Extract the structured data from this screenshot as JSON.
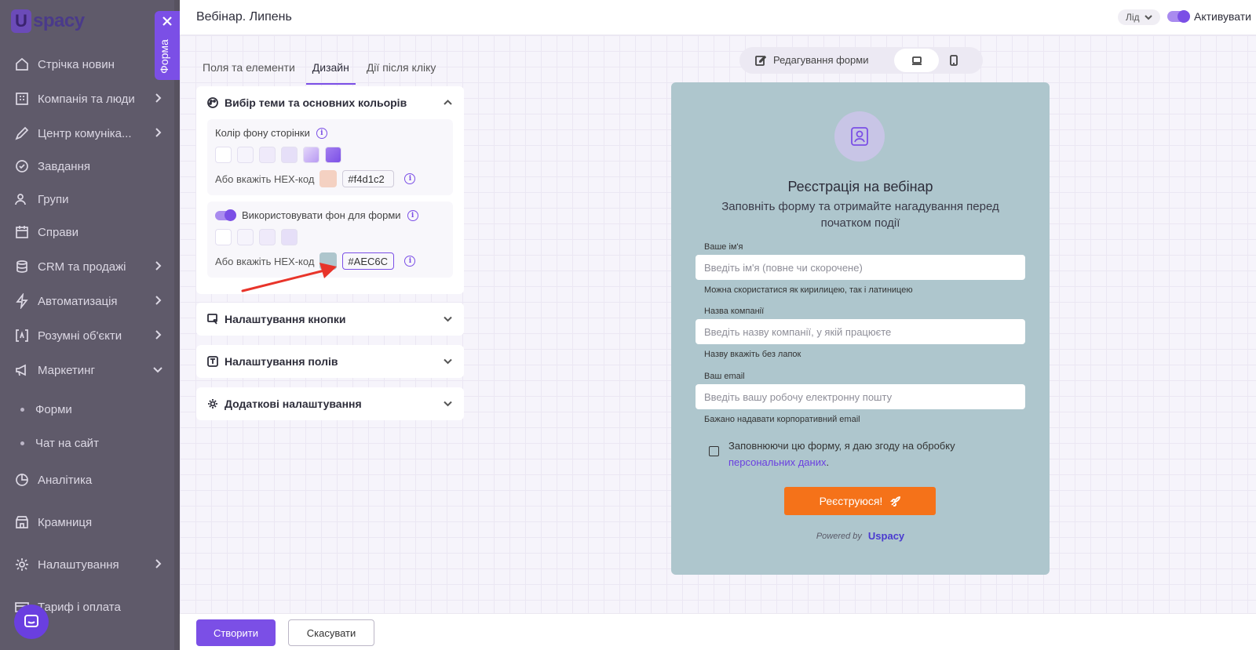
{
  "sidebar": {
    "logo_text": "spacy",
    "items": [
      {
        "label": "Стрічка новин"
      },
      {
        "label": "Компанія та люди"
      },
      {
        "label": "Центр комуніка..."
      },
      {
        "label": "Завдання"
      },
      {
        "label": "Групи"
      },
      {
        "label": "Справи"
      },
      {
        "label": "CRM та продажі"
      },
      {
        "label": "Автоматизація"
      },
      {
        "label": "Розумні об'єкти"
      },
      {
        "label": "Маркетинг"
      },
      {
        "label": "Аналітика"
      },
      {
        "label": "Крамниця"
      },
      {
        "label": "Налаштування"
      },
      {
        "label": "Тариф і оплата"
      }
    ],
    "sub_items": [
      {
        "label": "Форми"
      },
      {
        "label": "Чат на сайт"
      }
    ]
  },
  "forma_tab": {
    "label": "Форма"
  },
  "header": {
    "title": "Вебінар. Липень",
    "lead_select": "Лід",
    "activate_label": "Активувати"
  },
  "tabs": [
    {
      "label": "Поля та елементи"
    },
    {
      "label": "Дизайн"
    },
    {
      "label": "Дії після кліку"
    }
  ],
  "theme_panel": {
    "title": "Вибір теми та основних кольорів",
    "bg_label": "Колір фону сторінки",
    "hex_label": "Або вкажіть HEX-код",
    "bg_hex": "#f4d1c2",
    "form_bg_label": "Використовувати фон для форми",
    "form_hex_label": "Або вкажіть HEX-код",
    "form_hex": "#AEC6C"
  },
  "panels": {
    "button": "Налаштування кнопки",
    "fields": "Налаштування полів",
    "extra": "Додаткові налаштування"
  },
  "colors": {
    "page_swatches": [
      "#ffffff",
      "#f6f4fc",
      "#efeafa",
      "#e6dff8",
      "#cbb8f5",
      "#8d62ec"
    ],
    "form_swatches": [
      "#ffffff",
      "#f6f4fc",
      "#efeafa",
      "#e6dff8"
    ],
    "bg_hex_preview": "#f4d1c2",
    "form_hex_preview": "#AEC6CD",
    "accent": "#7b4fe6",
    "submit": "#f57219"
  },
  "bottom": {
    "create": "Створити",
    "cancel": "Скасувати"
  },
  "preview_bar": {
    "edit_label": "Редагування форми"
  },
  "form": {
    "title": "Реєстрація на вебінар",
    "subtitle": "Заповніть форму та отримайте нагадування перед початком події",
    "name_label": "Ваше ім'я",
    "name_placeholder": "Введіть ім'я (повне чи скорочене)",
    "name_hint": "Можна скористатися як кирилицею, так і латиницею",
    "company_label": "Назва компанії",
    "company_placeholder": "Введіть назву компанії, у якій працюєте",
    "company_hint": "Назву вкажіть без лапок",
    "email_label": "Ваш email",
    "email_placeholder": "Введіть вашу робочу електронну пошту",
    "email_hint": "Бажано надавати корпоративний email",
    "consent_text": "Заповнюючи цю форму, я даю згоду на обробку",
    "consent_link": "персональних даних",
    "consent_end": ".",
    "submit": "Реєструюся!",
    "powered_by": "Powered by",
    "brand": "spacy"
  }
}
